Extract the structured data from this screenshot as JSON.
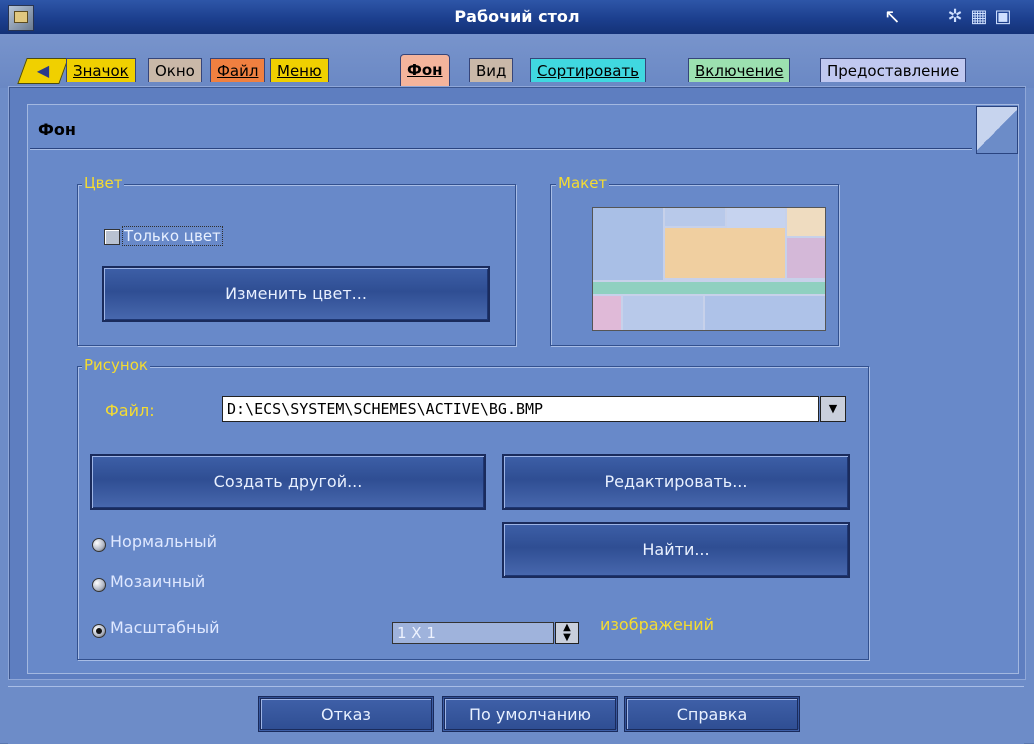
{
  "window": {
    "title": "Рабочий стол"
  },
  "titlebar_buttons": [
    "hide-icon",
    "minimize-icon",
    "maximize-icon"
  ],
  "tabs": [
    {
      "label": "Значок",
      "color": "#f0d000"
    },
    {
      "label": "Окно",
      "color": "#c9b8a8"
    },
    {
      "label": "Файл",
      "color": "#f08040"
    },
    {
      "label": "Меню",
      "color": "#f0d000"
    },
    {
      "label": "Фон",
      "color": "#f4b49c",
      "active": true
    },
    {
      "label": "Вид",
      "color": "#c9b8a8"
    },
    {
      "label": "Сортировать",
      "color": "#40d8e0"
    },
    {
      "label": "Включение",
      "color": "#9ce0b0"
    },
    {
      "label": "Предоставление",
      "color": "#c0c8f0"
    }
  ],
  "page": {
    "title": "Фон",
    "color_group": {
      "label": "Цвет",
      "checkbox_label": "Только цвет",
      "checkbox_checked": false,
      "change_color_button": "Изменить цвет..."
    },
    "layout_group": {
      "label": "Макет"
    },
    "image_group": {
      "label": "Рисунок",
      "file_label": "Файл:",
      "file_value": "D:\\ECS\\SYSTEM\\SCHEMES\\ACTIVE\\BG.BMP",
      "create_button": "Создать другой...",
      "edit_button": "Редактировать...",
      "find_button": "Найти...",
      "radio_options": [
        "Нормальный",
        "Мозаичный",
        "Масштабный"
      ],
      "selected_option": "Масштабный",
      "scale_value": "1 X 1",
      "scale_units": "изображений"
    }
  },
  "footer": {
    "cancel_button": "Отказ",
    "default_button": "По умолчанию",
    "help_button": "Справка"
  }
}
